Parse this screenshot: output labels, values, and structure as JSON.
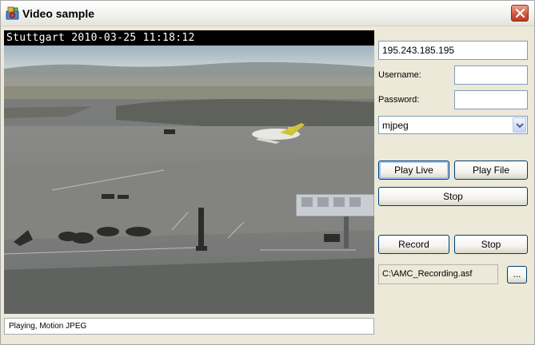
{
  "window": {
    "title": "Video sample",
    "icon": "camera-app-icon"
  },
  "video": {
    "overlay_text": "Stuttgart 2010-03-25 11:18:12",
    "status_text": "Playing, Motion JPEG"
  },
  "connection": {
    "address": "195.243.185.195",
    "username_label": "Username:",
    "username_value": "",
    "password_label": "Password:",
    "password_value": "",
    "format_selected": "mjpeg"
  },
  "playback": {
    "play_live_label": "Play Live",
    "play_file_label": "Play File",
    "stop_label": "Stop"
  },
  "recording": {
    "record_label": "Record",
    "stop_label": "Stop",
    "file_path": "C:\\AMC_Recording.asf",
    "browse_label": "..."
  },
  "colors": {
    "window_bg": "#ece9d8",
    "button_border": "#003c74",
    "close_button": "#d0573f"
  }
}
